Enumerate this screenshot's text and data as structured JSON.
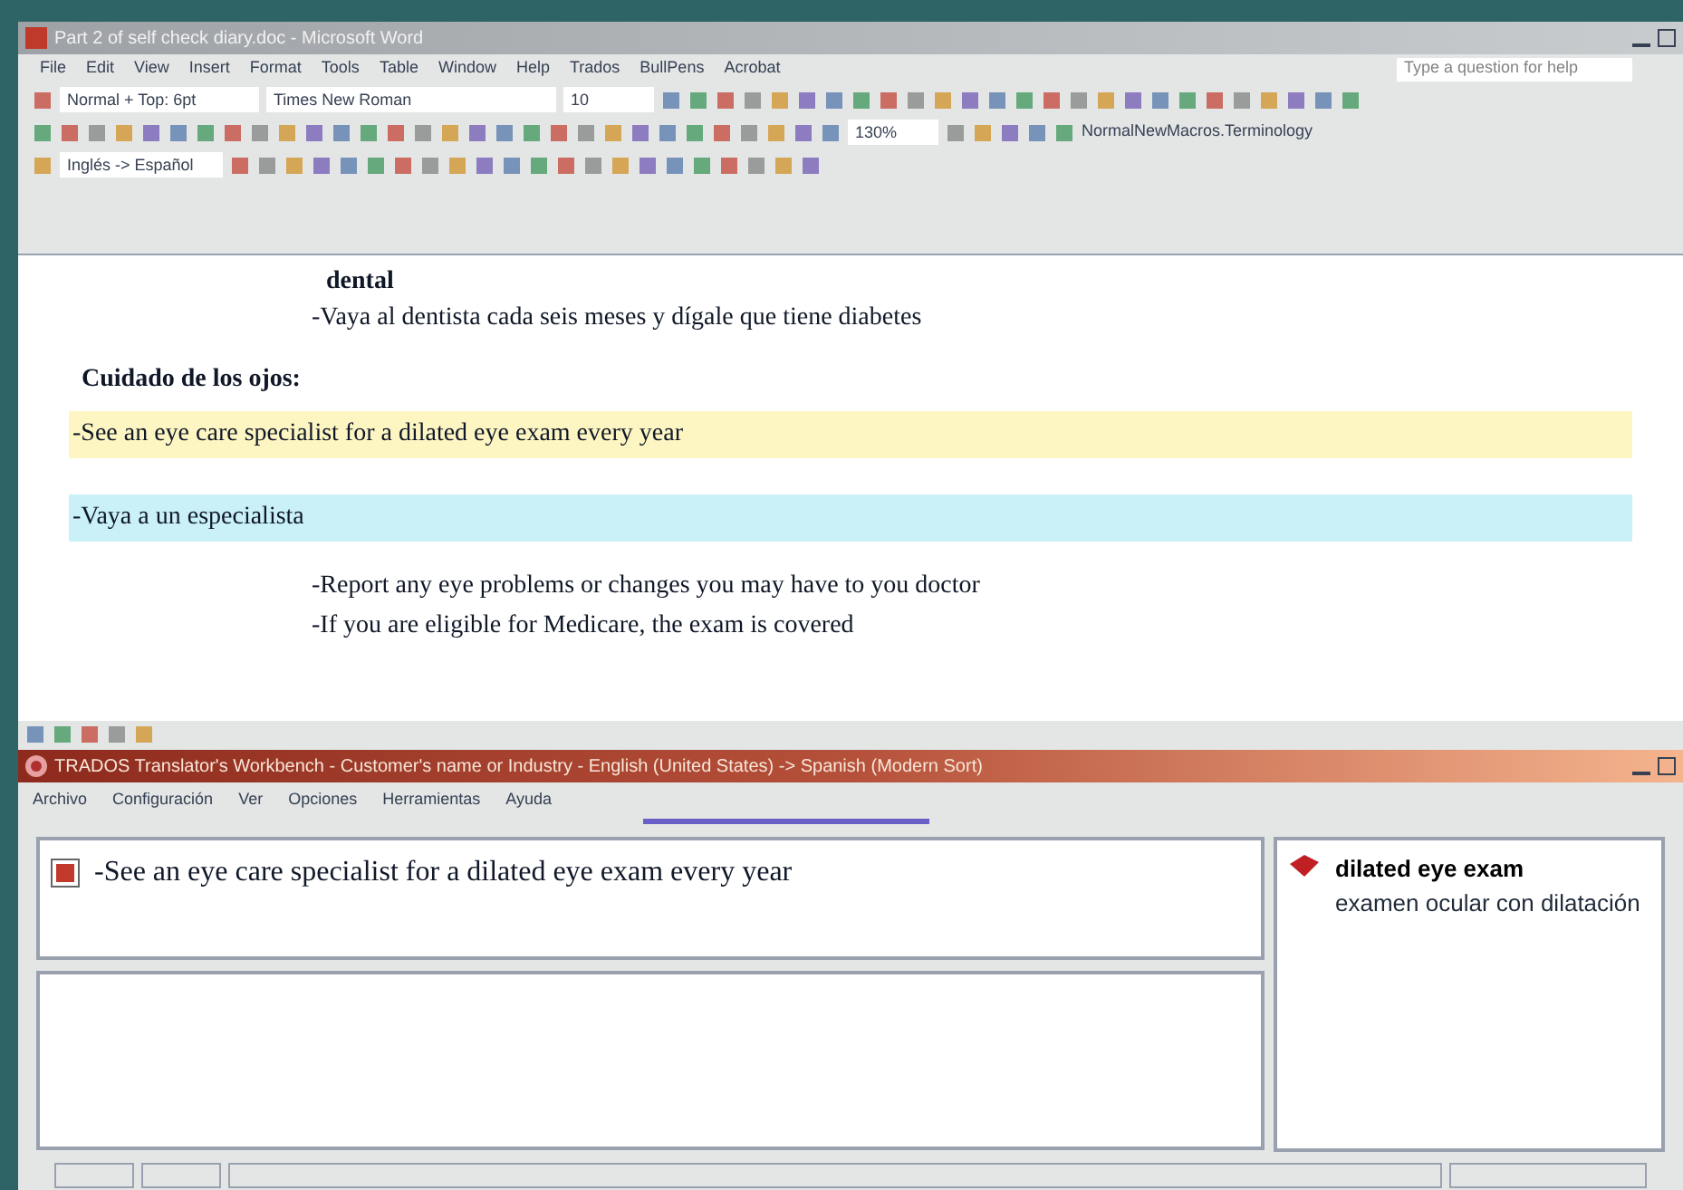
{
  "word_window": {
    "title": "Part 2 of self check diary.doc - Microsoft Word",
    "menu": [
      "File",
      "Edit",
      "View",
      "Insert",
      "Format",
      "Tools",
      "Table",
      "Window",
      "Help",
      "Trados",
      "BullPens",
      "Acrobat"
    ],
    "help_box": {
      "placeholder": "Type a question for help"
    },
    "formatting": {
      "style": "Normal + Top: 6pt",
      "font": "Times New Roman",
      "size": "10"
    },
    "standard": {
      "zoom": "130%",
      "macro": "NormalNewMacros.Terminology"
    },
    "trados_bar": {
      "language": "Inglés -> Español"
    },
    "paragraphs": [
      {
        "kind": "sub",
        "text": "dental"
      },
      {
        "kind": "indented",
        "text": "-Vaya al dentista cada seis meses y dígale que tiene diabetes"
      },
      {
        "kind": "heading",
        "text": "Cuidado de los ojos:"
      },
      {
        "kind": "highlighted",
        "color": "#fdf6c3",
        "text": "-See an eye care specialist for a dilated eye exam every year"
      },
      {
        "kind": "highlighted",
        "color": "#c9f1f7",
        "text": "-Vaya a un especialista"
      },
      {
        "kind": "indented",
        "text": "-Report any eye problems or changes you may have to you doctor"
      },
      {
        "kind": "indented",
        "text": "-If you are eligible for Medicare, the exam is covered"
      }
    ]
  },
  "workbench": {
    "title": "TRADOS Translator's Workbench - Customer's name or Industry - English (United States) -> Spanish (Modern Sort)",
    "menu": [
      "Archivo",
      "Configuración",
      "Ver",
      "Opciones",
      "Herramientas",
      "Ayuda"
    ],
    "source_segment": "-See an eye care specialist for a dilated eye exam every year",
    "term": {
      "source": "dilated eye exam",
      "target": "examen ocular con dilatación"
    }
  }
}
